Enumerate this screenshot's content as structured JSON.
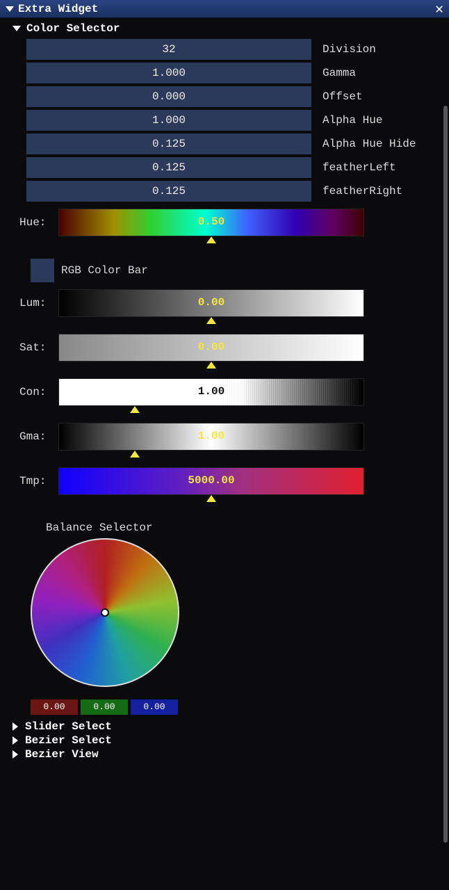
{
  "window": {
    "title": "Extra Widget"
  },
  "colorSelector": {
    "header": "Color Selector",
    "fields": [
      {
        "value": "32",
        "label": "Division"
      },
      {
        "value": "1.000",
        "label": "Gamma"
      },
      {
        "value": "0.000",
        "label": "Offset"
      },
      {
        "value": "1.000",
        "label": "Alpha Hue"
      },
      {
        "value": "0.125",
        "label": "Alpha Hue Hide"
      },
      {
        "value": "0.125",
        "label": "featherLeft"
      },
      {
        "value": "0.125",
        "label": "featherRight"
      }
    ],
    "hue": {
      "label": "Hue:",
      "value": "0.50",
      "markerPct": 50
    },
    "rgbBar": {
      "label": "RGB Color Bar",
      "swatchColor": "#2b3a5a"
    },
    "sliders": {
      "lum": {
        "label": "Lum:",
        "value": "0.00",
        "markerPct": 50,
        "valueClass": "yellow"
      },
      "sat": {
        "label": "Sat:",
        "value": "0.00",
        "markerPct": 50,
        "valueClass": "yellow"
      },
      "con": {
        "label": "Con:",
        "value": "1.00",
        "markerPct": 25,
        "valueClass": "dark"
      },
      "gma": {
        "label": "Gma:",
        "value": "1.00",
        "markerPct": 25,
        "valueClass": "yellow"
      },
      "tmp": {
        "label": "Tmp:",
        "value": "5000.00",
        "markerPct": 50,
        "valueClass": "yellow"
      }
    },
    "balance": {
      "header": "Balance Selector",
      "r": "0.00",
      "g": "0.00",
      "b": "0.00"
    }
  },
  "collapsedSections": [
    "Slider Select",
    "Bezier Select",
    "Bezier View"
  ]
}
